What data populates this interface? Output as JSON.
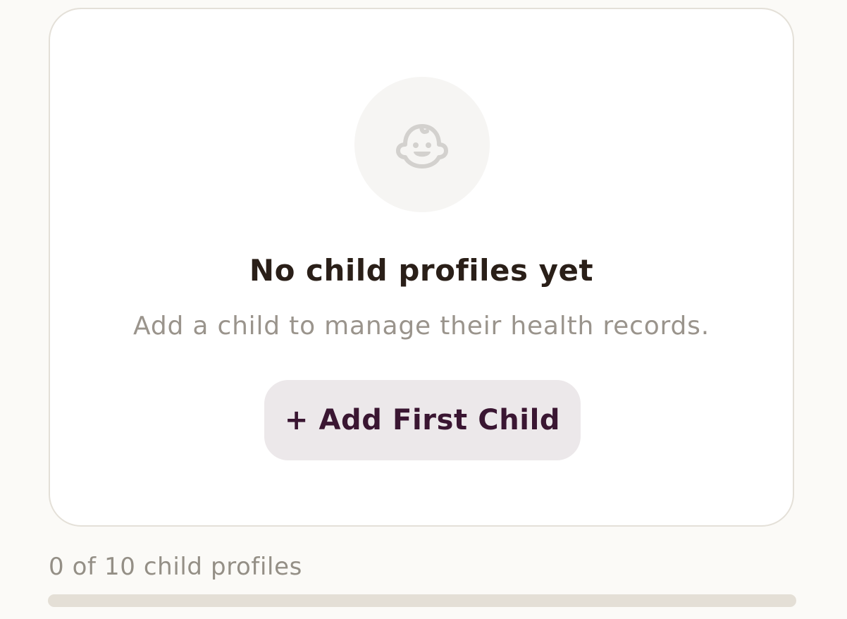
{
  "empty_state": {
    "icon": "baby-face-icon",
    "title": "No child profiles yet",
    "subtitle": "Add a child to manage their health records.",
    "add_button_label": "+ Add First Child"
  },
  "capacity": {
    "label": "0 of 10 child profiles",
    "current": 0,
    "max": 10
  },
  "colors": {
    "button_text": "#3a1632",
    "button_bg": "#ece8ea",
    "track": "#e4dfd6"
  }
}
